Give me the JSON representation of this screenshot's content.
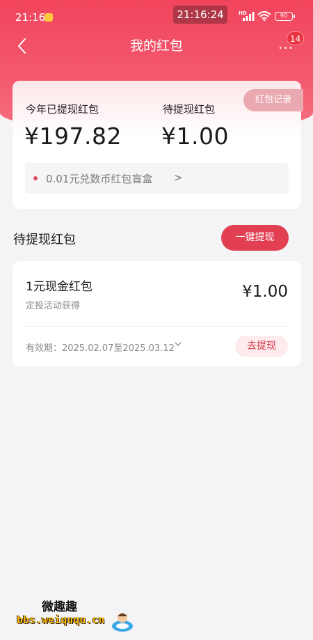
{
  "status_bar": {
    "time": "21:16",
    "center_time": "21:16:24",
    "network": "HD",
    "battery": "90"
  },
  "nav": {
    "title": "我的红包",
    "badge_count": "14"
  },
  "summary": {
    "withdrawn_label": "今年已提现红包",
    "withdrawn_amount": "¥197.82",
    "pending_label": "待提现红包",
    "pending_amount": "¥1.00",
    "record_button": "红包记录",
    "promo_text": "0.01元兑数币红包盲盒",
    "promo_arrow": ">"
  },
  "section": {
    "title": "待提现红包",
    "withdraw_all_button": "一键提现"
  },
  "items": [
    {
      "title": "1元现金红包",
      "source": "定投活动获得",
      "amount": "¥1.00",
      "validity": "有效期：2025.02.07至2025.03.12",
      "action": "去提现"
    }
  ],
  "watermark": {
    "name": "微趣趣",
    "url": "bbs.weiququ.cn"
  },
  "colors": {
    "brand_red": "#f2445d",
    "button_red": "#e23f52",
    "background": "#f4f4f6"
  }
}
